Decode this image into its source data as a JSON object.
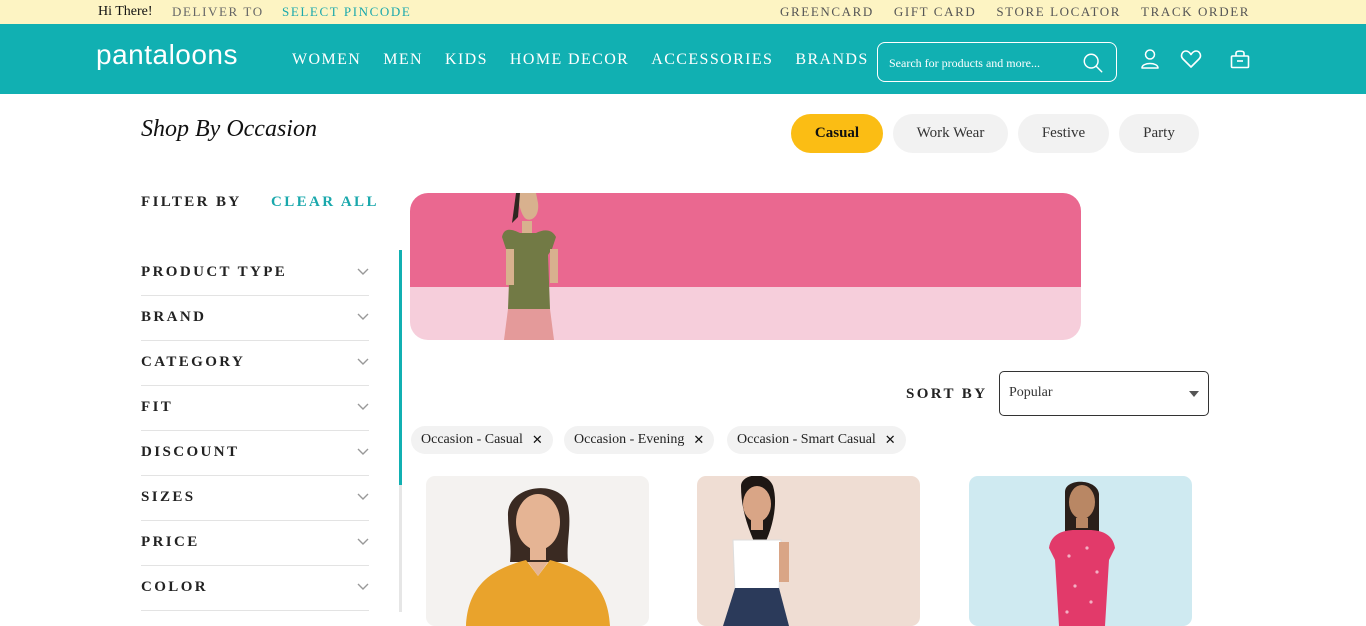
{
  "topbar": {
    "greeting": "Hi There!",
    "deliver_to": "DELIVER TO",
    "select_pincode": "SELECT PINCODE",
    "links": [
      "GREENCARD",
      "GIFT CARD",
      "STORE LOCATOR",
      "TRACK ORDER"
    ]
  },
  "header": {
    "logo": "pantaloons",
    "nav": [
      "WOMEN",
      "MEN",
      "KIDS",
      "HOME DECOR",
      "ACCESSORIES",
      "BRANDS"
    ],
    "search_placeholder": "Search for products and more...",
    "icons": [
      "user-icon",
      "heart-icon",
      "bag-icon"
    ]
  },
  "occasion": {
    "title": "Shop By Occasion",
    "pills": [
      "Casual",
      "Work Wear",
      "Festive",
      "Party"
    ],
    "active": "Casual"
  },
  "filter": {
    "title": "FILTER BY",
    "clear_all": "CLEAR ALL",
    "facets": [
      "PRODUCT TYPE",
      "BRAND",
      "CATEGORY",
      "FIT",
      "DISCOUNT",
      "SIZES",
      "PRICE",
      "COLOR"
    ]
  },
  "sort": {
    "label": "SORT BY",
    "selected": "Popular"
  },
  "applied_filters": [
    "Occasion - Casual",
    "Occasion - Evening",
    "Occasion - Smart Casual"
  ],
  "colors": {
    "brand": "#11b0b2",
    "accent": "#fbbd14",
    "banner_top": "#ea6890",
    "banner_bottom": "#f6cedb"
  }
}
